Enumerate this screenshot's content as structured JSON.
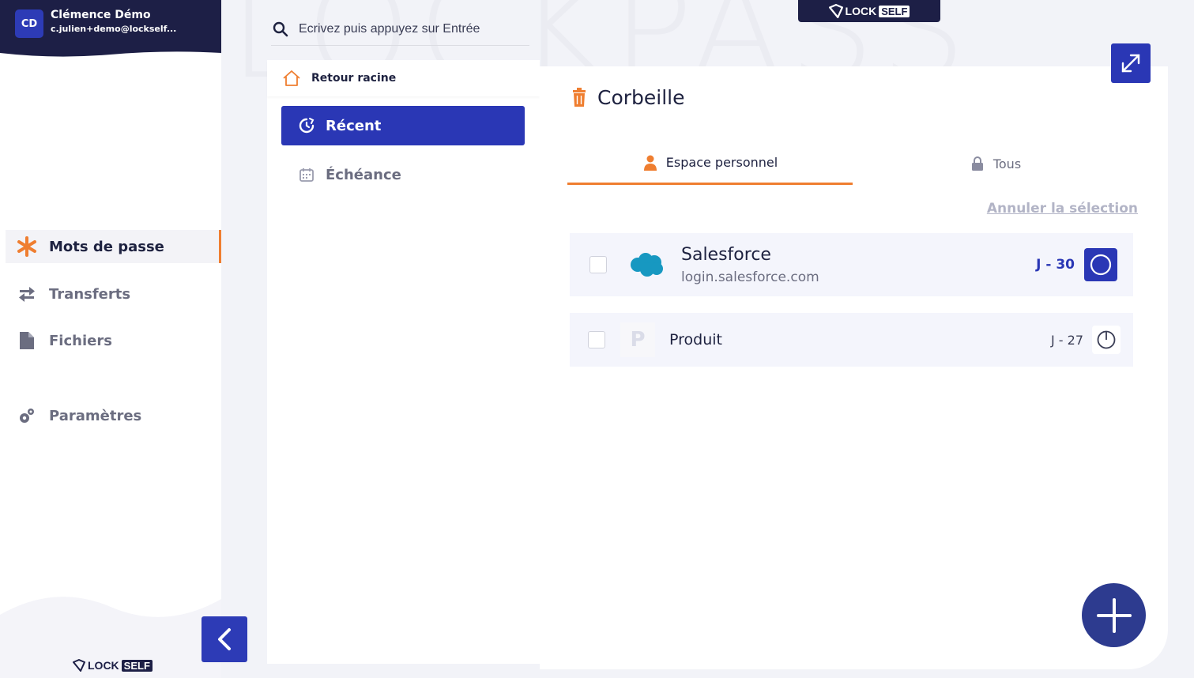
{
  "user": {
    "initials": "CD",
    "name": "Clémence Démo",
    "email": "c.julien+demo@lockself..."
  },
  "watermark": "LOCKPASS",
  "brand": {
    "word1": "LOCK",
    "word2": "SELF"
  },
  "search": {
    "placeholder": "Ecrivez puis appuyez sur Entrée"
  },
  "sidebar": {
    "items": [
      {
        "label": "Mots de passe",
        "icon": "star-icon",
        "active": true
      },
      {
        "label": "Transferts",
        "icon": "transfer-arrows-icon"
      },
      {
        "label": "Fichiers",
        "icon": "file-icon"
      },
      {
        "label": "Paramètres",
        "icon": "gears-icon"
      }
    ]
  },
  "folders": {
    "back_root": "Retour racine",
    "recent": "Récent",
    "due": "Échéance"
  },
  "main": {
    "title": "Corbeille",
    "tabs": [
      {
        "label": "Espace personnel",
        "icon": "person-icon",
        "active": true
      },
      {
        "label": "Tous",
        "icon": "lock-icon"
      }
    ],
    "cancel_selection": "Annuler la sélection",
    "items": [
      {
        "name": "Salesforce",
        "url": "login.salesforce.com",
        "due": "J - 30",
        "logo": "salesforce-cloud-icon"
      },
      {
        "name": "Produit",
        "letter": "P",
        "due": "J - 27"
      }
    ]
  },
  "colors": {
    "accent": "#2a37b5",
    "orange": "#ef7e30",
    "navy": "#1d1f46"
  }
}
